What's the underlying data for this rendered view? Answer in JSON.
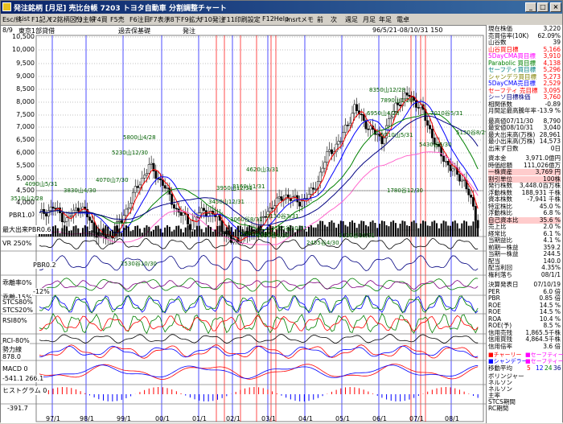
{
  "window": {
    "title": "発注銘柄 [月足] 売比台帳   7203 トヨタ自動車  分割調整チャート",
    "buttons": {
      "minimize": "_",
      "maximize": "□",
      "close": "×"
    }
  },
  "menu": [
    "Esc/終",
    "List",
    "F1記入",
    "F2銘柄区分",
    "F3主帳",
    "F4買",
    "F5売",
    "F6注目",
    "F7表示",
    "F8下",
    "F9拡大",
    "F10発注",
    "F11印刷設定",
    "F12Help",
    "Insrtメモ",
    "前",
    "次",
    "週足",
    "月足",
    "年足",
    "電卓"
  ],
  "chart_header": {
    "date_left": "8/9",
    "labels": [
      "東京1部貸借",
      "過去保基礎",
      "発注"
    ],
    "period": "96/5/21-08/10/31 150"
  },
  "y_axis_ticks": [
    "10,500",
    "10,000",
    "9,500",
    "9,000",
    "8,500",
    "8,000",
    "7,500",
    "7,000",
    "6,500",
    "6,000",
    "5,500",
    "5,000",
    "4,500",
    "4,000",
    "3,500",
    "3,000",
    "2,500"
  ],
  "x_axis_ticks": [
    "97/1",
    "98/1",
    "99/1",
    "00/1",
    "01/1",
    "02/1",
    "03/1",
    "04/1",
    "05/1",
    "06/1",
    "07/1",
    "08/1"
  ],
  "sub_panels": {
    "max_volume": "最大出来PBR0.6",
    "vr": "VR 250%",
    "pbr": "PBR0.2",
    "deviation": "乖離率0%",
    "deviation_low": "乖離-15%",
    "deviation_low_val": "-12%",
    "stcs80": "STCS80%",
    "stcs20": "STCS20%",
    "rsi": "RSI80%",
    "rci": "RCI-80%",
    "momentum": "勢力線",
    "momentum_val": "878.0",
    "macd": "MACD 0",
    "macd_vals": "-541.1 266.1",
    "histogram": "ヒストグラム 0",
    "histogram_val": "-391.7",
    "pbr_line": "PBR1.0"
  },
  "annotations": [
    "8350山12/28",
    "7890山1/28",
    "7010谷5/31",
    "5130谷8/29",
    "6950山4/28",
    "5710山5/31",
    "5430谷6/30",
    "5800山4/28",
    "5230山12/30",
    "4620山3/31",
    "4070山7/30",
    "3830山4/30",
    "4090山5/31",
    "3510山2/28",
    "3950山12/31",
    "3450山12/31",
    "3160山1/31",
    "3130谷3/31",
    "3130谷10/31",
    "2530谷10/30",
    "2455谷4/30",
    "2555谷10/31",
    "3380谷4/30",
    "3060谷8/31",
    "2685谷10/31",
    "1780谷12/30"
  ],
  "info_panel": {
    "rows": [
      [
        "現在株価",
        "3,220"
      ],
      [
        "売買倍率(10K)",
        "62.09%"
      ],
      [
        "山谷数",
        "39"
      ],
      [
        "山谷買日標",
        "5,166"
      ],
      [
        "5DayCMA買目標",
        "3,910"
      ],
      [
        "Parabolic 買目標",
        "4,138"
      ],
      [
        "セーフティ買目標",
        "5,296"
      ],
      [
        "シャンデラ買目標",
        "5,273"
      ],
      [
        "5DayCMA売目標",
        "2,529"
      ],
      [
        "セーフティ 売目標",
        "3,095"
      ],
      [
        "シーソ目標株価",
        "3,760"
      ],
      [
        "相関係数",
        "-0.89"
      ],
      [
        "月間足最高騰年率",
        "-13.9 %"
      ],
      [
        "最高値07/11/30",
        "8,790"
      ],
      [
        "最安値08/10/31",
        "3,040"
      ],
      [
        "最大出来高(万株)",
        "28,961"
      ],
      [
        "最小出来高(万株)",
        "14,573"
      ],
      [
        "出来ず日数",
        "0日"
      ],
      [
        "資本金",
        "3,971.0億円"
      ],
      [
        "時価総額",
        "111,026億万"
      ],
      [
        "一株資産",
        "3,769 円"
      ],
      [
        "割引単位",
        "100株"
      ],
      [
        "発行株数",
        "3,448.0百万株"
      ],
      [
        "浮動株数",
        "188,931 千株"
      ],
      [
        "資本株数",
        "-7,941 千株"
      ],
      [
        "特定株比",
        "45.0 %"
      ],
      [
        "浮動株比",
        "6.8 %"
      ],
      [
        "自己資本比",
        "35.6 %"
      ],
      [
        "売上比",
        "2.0 %"
      ],
      [
        "経常比",
        "6.1 %"
      ],
      [
        "当期益比",
        "4.1 %"
      ],
      [
        "前期一株益",
        "359.2"
      ],
      [
        "当期一株益",
        "244.5"
      ],
      [
        "配当",
        "140.0"
      ],
      [
        "配当利回",
        "4.35%"
      ],
      [
        "権利落ち",
        "08/1/1"
      ],
      [
        "決算発表日",
        "07/10/19"
      ],
      [
        "PER",
        "6.0 倍"
      ],
      [
        "PBR",
        "0.85 倍"
      ],
      [
        "ROE",
        "14.5 %"
      ],
      [
        "ROE",
        "14.5 %"
      ],
      [
        "ROA",
        "10.4 %"
      ],
      [
        "ROE(予)",
        "8.5 %"
      ],
      [
        "信用売残",
        "1,865.5千株"
      ],
      [
        "信用買残",
        "4,864.5千株"
      ],
      [
        "信用倍率",
        "3.6 倍"
      ]
    ],
    "legend": [
      "チャーリー",
      "セーフティー",
      "シャンデラー",
      "セーフティー売"
    ],
    "ma_label": "移動平均",
    "ma_vals": [
      "5",
      "12",
      "24",
      "36"
    ],
    "bottom": [
      "ボリンジャー",
      "ネルソン",
      "ネルソン",
      "主率",
      "STCS期間",
      "RC期間"
    ]
  },
  "colors": {
    "ma5": "#ff0000",
    "ma12": "#0000ff",
    "ma24": "#008000",
    "ma36": "#000080",
    "envelope": "#ff66cc",
    "price_up": "#ffffff",
    "price_down": "#000000",
    "vline_red": "#ff0000",
    "vline_blue": "#0000ff"
  }
}
